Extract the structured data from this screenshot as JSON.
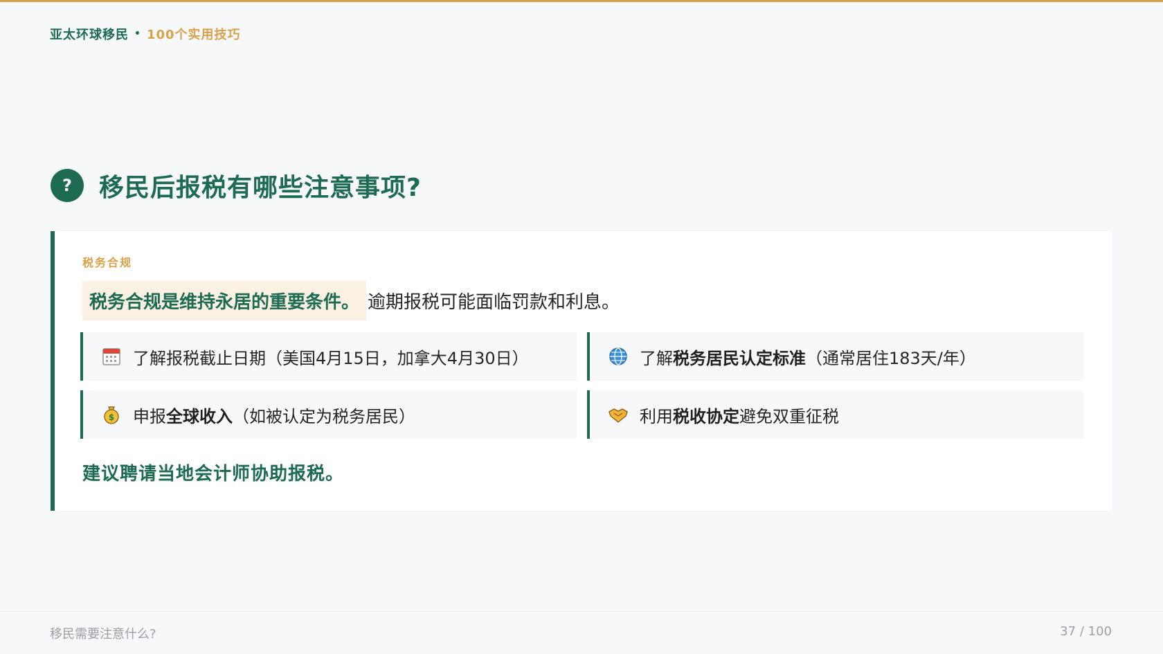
{
  "header": {
    "brand_name": "亚太环球移民",
    "separator": "•",
    "series": "100个实用技巧"
  },
  "question": {
    "badge": "?",
    "title": "移民后报税有哪些注意事项?"
  },
  "card": {
    "label": "税务合规",
    "lead_highlight": "税务合规是维持永居的重要条件。",
    "lead_rest": "逾期报税可能面临罚款和利息。",
    "items": [
      {
        "icon": "calendar-icon",
        "pre": "了解报税截止日期（美国4月15日，加拿大4月30日）",
        "bold": "",
        "post": ""
      },
      {
        "icon": "globe-icon",
        "pre": "了解",
        "bold": "税务居民认定标准",
        "post": "（通常居住183天/年）"
      },
      {
        "icon": "money-bag-icon",
        "pre": "申报",
        "bold": "全球收入",
        "post": "（如被认定为税务居民）"
      },
      {
        "icon": "handshake-icon",
        "pre": "利用",
        "bold": "税收协定",
        "post": "避免双重征税"
      }
    ],
    "advice": "建议聘请当地会计师协助报税。"
  },
  "footer": {
    "left": "移民需要注意什么?",
    "page": "37 / 100"
  },
  "colors": {
    "primary": "#1c6b52",
    "accent": "#d9a24a",
    "highlight_bg": "#fbf1e3",
    "page_bg": "#f7f8f9"
  }
}
